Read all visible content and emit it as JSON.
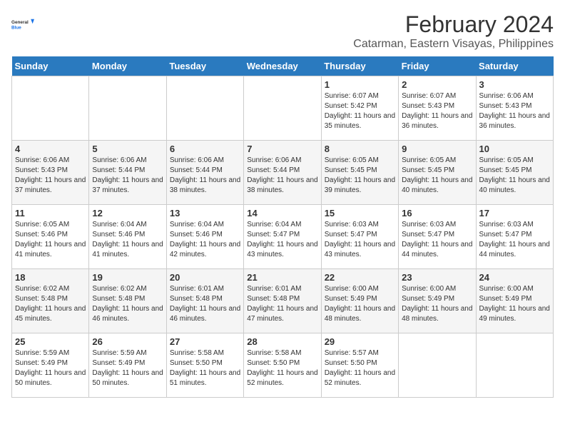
{
  "logo": {
    "line1": "General",
    "line2": "Blue"
  },
  "title": "February 2024",
  "subtitle": "Catarman, Eastern Visayas, Philippines",
  "days_header": [
    "Sunday",
    "Monday",
    "Tuesday",
    "Wednesday",
    "Thursday",
    "Friday",
    "Saturday"
  ],
  "weeks": [
    [
      {
        "day": "",
        "info": ""
      },
      {
        "day": "",
        "info": ""
      },
      {
        "day": "",
        "info": ""
      },
      {
        "day": "",
        "info": ""
      },
      {
        "day": "1",
        "info": "Sunrise: 6:07 AM\nSunset: 5:42 PM\nDaylight: 11 hours and 35 minutes."
      },
      {
        "day": "2",
        "info": "Sunrise: 6:07 AM\nSunset: 5:43 PM\nDaylight: 11 hours and 36 minutes."
      },
      {
        "day": "3",
        "info": "Sunrise: 6:06 AM\nSunset: 5:43 PM\nDaylight: 11 hours and 36 minutes."
      }
    ],
    [
      {
        "day": "4",
        "info": "Sunrise: 6:06 AM\nSunset: 5:43 PM\nDaylight: 11 hours and 37 minutes."
      },
      {
        "day": "5",
        "info": "Sunrise: 6:06 AM\nSunset: 5:44 PM\nDaylight: 11 hours and 37 minutes."
      },
      {
        "day": "6",
        "info": "Sunrise: 6:06 AM\nSunset: 5:44 PM\nDaylight: 11 hours and 38 minutes."
      },
      {
        "day": "7",
        "info": "Sunrise: 6:06 AM\nSunset: 5:44 PM\nDaylight: 11 hours and 38 minutes."
      },
      {
        "day": "8",
        "info": "Sunrise: 6:05 AM\nSunset: 5:45 PM\nDaylight: 11 hours and 39 minutes."
      },
      {
        "day": "9",
        "info": "Sunrise: 6:05 AM\nSunset: 5:45 PM\nDaylight: 11 hours and 40 minutes."
      },
      {
        "day": "10",
        "info": "Sunrise: 6:05 AM\nSunset: 5:45 PM\nDaylight: 11 hours and 40 minutes."
      }
    ],
    [
      {
        "day": "11",
        "info": "Sunrise: 6:05 AM\nSunset: 5:46 PM\nDaylight: 11 hours and 41 minutes."
      },
      {
        "day": "12",
        "info": "Sunrise: 6:04 AM\nSunset: 5:46 PM\nDaylight: 11 hours and 41 minutes."
      },
      {
        "day": "13",
        "info": "Sunrise: 6:04 AM\nSunset: 5:46 PM\nDaylight: 11 hours and 42 minutes."
      },
      {
        "day": "14",
        "info": "Sunrise: 6:04 AM\nSunset: 5:47 PM\nDaylight: 11 hours and 43 minutes."
      },
      {
        "day": "15",
        "info": "Sunrise: 6:03 AM\nSunset: 5:47 PM\nDaylight: 11 hours and 43 minutes."
      },
      {
        "day": "16",
        "info": "Sunrise: 6:03 AM\nSunset: 5:47 PM\nDaylight: 11 hours and 44 minutes."
      },
      {
        "day": "17",
        "info": "Sunrise: 6:03 AM\nSunset: 5:47 PM\nDaylight: 11 hours and 44 minutes."
      }
    ],
    [
      {
        "day": "18",
        "info": "Sunrise: 6:02 AM\nSunset: 5:48 PM\nDaylight: 11 hours and 45 minutes."
      },
      {
        "day": "19",
        "info": "Sunrise: 6:02 AM\nSunset: 5:48 PM\nDaylight: 11 hours and 46 minutes."
      },
      {
        "day": "20",
        "info": "Sunrise: 6:01 AM\nSunset: 5:48 PM\nDaylight: 11 hours and 46 minutes."
      },
      {
        "day": "21",
        "info": "Sunrise: 6:01 AM\nSunset: 5:48 PM\nDaylight: 11 hours and 47 minutes."
      },
      {
        "day": "22",
        "info": "Sunrise: 6:00 AM\nSunset: 5:49 PM\nDaylight: 11 hours and 48 minutes."
      },
      {
        "day": "23",
        "info": "Sunrise: 6:00 AM\nSunset: 5:49 PM\nDaylight: 11 hours and 48 minutes."
      },
      {
        "day": "24",
        "info": "Sunrise: 6:00 AM\nSunset: 5:49 PM\nDaylight: 11 hours and 49 minutes."
      }
    ],
    [
      {
        "day": "25",
        "info": "Sunrise: 5:59 AM\nSunset: 5:49 PM\nDaylight: 11 hours and 50 minutes."
      },
      {
        "day": "26",
        "info": "Sunrise: 5:59 AM\nSunset: 5:49 PM\nDaylight: 11 hours and 50 minutes."
      },
      {
        "day": "27",
        "info": "Sunrise: 5:58 AM\nSunset: 5:50 PM\nDaylight: 11 hours and 51 minutes."
      },
      {
        "day": "28",
        "info": "Sunrise: 5:58 AM\nSunset: 5:50 PM\nDaylight: 11 hours and 52 minutes."
      },
      {
        "day": "29",
        "info": "Sunrise: 5:57 AM\nSunset: 5:50 PM\nDaylight: 11 hours and 52 minutes."
      },
      {
        "day": "",
        "info": ""
      },
      {
        "day": "",
        "info": ""
      }
    ]
  ]
}
